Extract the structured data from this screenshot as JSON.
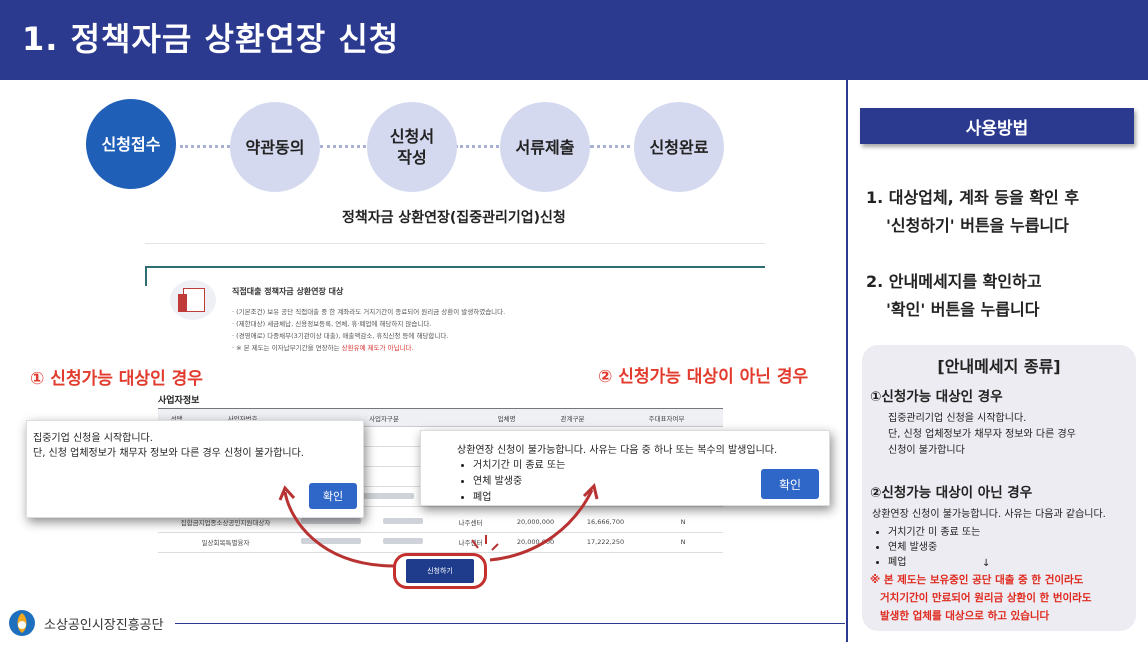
{
  "header": {
    "title": "1. 정책자금 상환연장 신청"
  },
  "steps": [
    {
      "label": "신청접수",
      "active": true
    },
    {
      "label": "약관동의",
      "active": false
    },
    {
      "label": "신청서\n작성",
      "active": false
    },
    {
      "label": "서류제출",
      "active": false
    },
    {
      "label": "신청완료",
      "active": false
    }
  ],
  "main": {
    "subtitle": "정책자금 상환연장(집중관리기업)신청",
    "doc": {
      "title": "직접대출 정책자금 상환연장 대상",
      "lines": [
        "· (기본조건) 보유 공단 직접대출 중 한 계좌라도 거치기간이 종료되어 원리금 상환이 발생하였습니다.",
        "· (제한대상) 세금체납, 신용정보등록, 연체, 휴·폐업에 해당하지 않습니다.",
        "· (경영애로) 다중채무(3기관이상 대출), 매출액감소, 휴직신청 등에 해당합니다.",
        "· ※ 본 제도는 이자납부기간을 연장하는 ",
        "상환유예 제도가 아닙니다."
      ]
    },
    "case1_title": "① 신청가능 대상인 경우",
    "case2_title": "② 신청가능 대상이 아닌 경우",
    "table": {
      "section_label": "사업자정보",
      "headers": [
        "선택",
        "사업자번호",
        "사업자구분",
        "업체명",
        "관계구분",
        "주대표자여부"
      ],
      "row_label_a": "사업자",
      "row_label_b": "사업자번",
      "rows": [
        [
          "집합금지업종소상공인지원대상자",
          "",
          "",
          "나주센터",
          "20,000,000",
          "16,666,700",
          "N"
        ],
        [
          "일상회복특별융자",
          "",
          "",
          "나주센터",
          "20,000,000",
          "17,222,250",
          "N"
        ]
      ]
    },
    "popup1": {
      "line1": "집중기업 신청을 시작합니다.",
      "line2": "단, 신청 업체정보가 채무자 정보와 다른 경우 신청이 불가합니다.",
      "confirm": "확인"
    },
    "popup2": {
      "message": "상환연장 신청이 불가능합니다. 사유는 다음 중 하나 또는 복수의 발생입니다.",
      "reasons": [
        "거치기간 미 종료 또는",
        "연체 발생중",
        "폐업"
      ],
      "confirm": "확인"
    },
    "apply_button": "신청하기"
  },
  "footer": {
    "org_name": "소상공인시장진흥공단"
  },
  "side": {
    "header": "사용방법",
    "step1_line1": "1. 대상업체, 계좌 등을 확인 후",
    "step1_line2": "'신청하기' 버튼을 누릅니다",
    "step2_line1": "2. 안내메세지를 확인하고",
    "step2_line2": "'확인' 버튼을 누릅니다",
    "info": {
      "title": "[안내메세지 종류]",
      "case1_title": "①신청가능 대상인 경우",
      "case1_line1": "집중관리기업 신청을 시작합니다.",
      "case1_line2": "단, 신청 업체정보가 채무자 정보와 다른 경우",
      "case1_line3": "신청이 불가합니다",
      "case2_title": "②신청가능 대상이 아닌 경우",
      "case2_line": "상환연장 신청이 불가능합니다. 사유는 다음과 같습니다.",
      "case2_reasons": [
        "거치기간 미 종료 또는",
        "연체 발생중",
        "폐업"
      ],
      "case2_arrow": "↓",
      "note_line1": "※ 본 제도는 보유중인  공단 대출 중 한 건이라도",
      "note_line2": "거치기간이 만료되어 원리금 상환이 한 번이라도",
      "note_line3": "발생한 업체를 대상으로 하고 있습니다"
    }
  },
  "colors": {
    "brand_navy": "#2b3a8f",
    "step_active": "#1f5fb8",
    "step_inactive": "#d4d9ef",
    "alert_red": "#e23b2e",
    "button_blue": "#2f67c8"
  }
}
